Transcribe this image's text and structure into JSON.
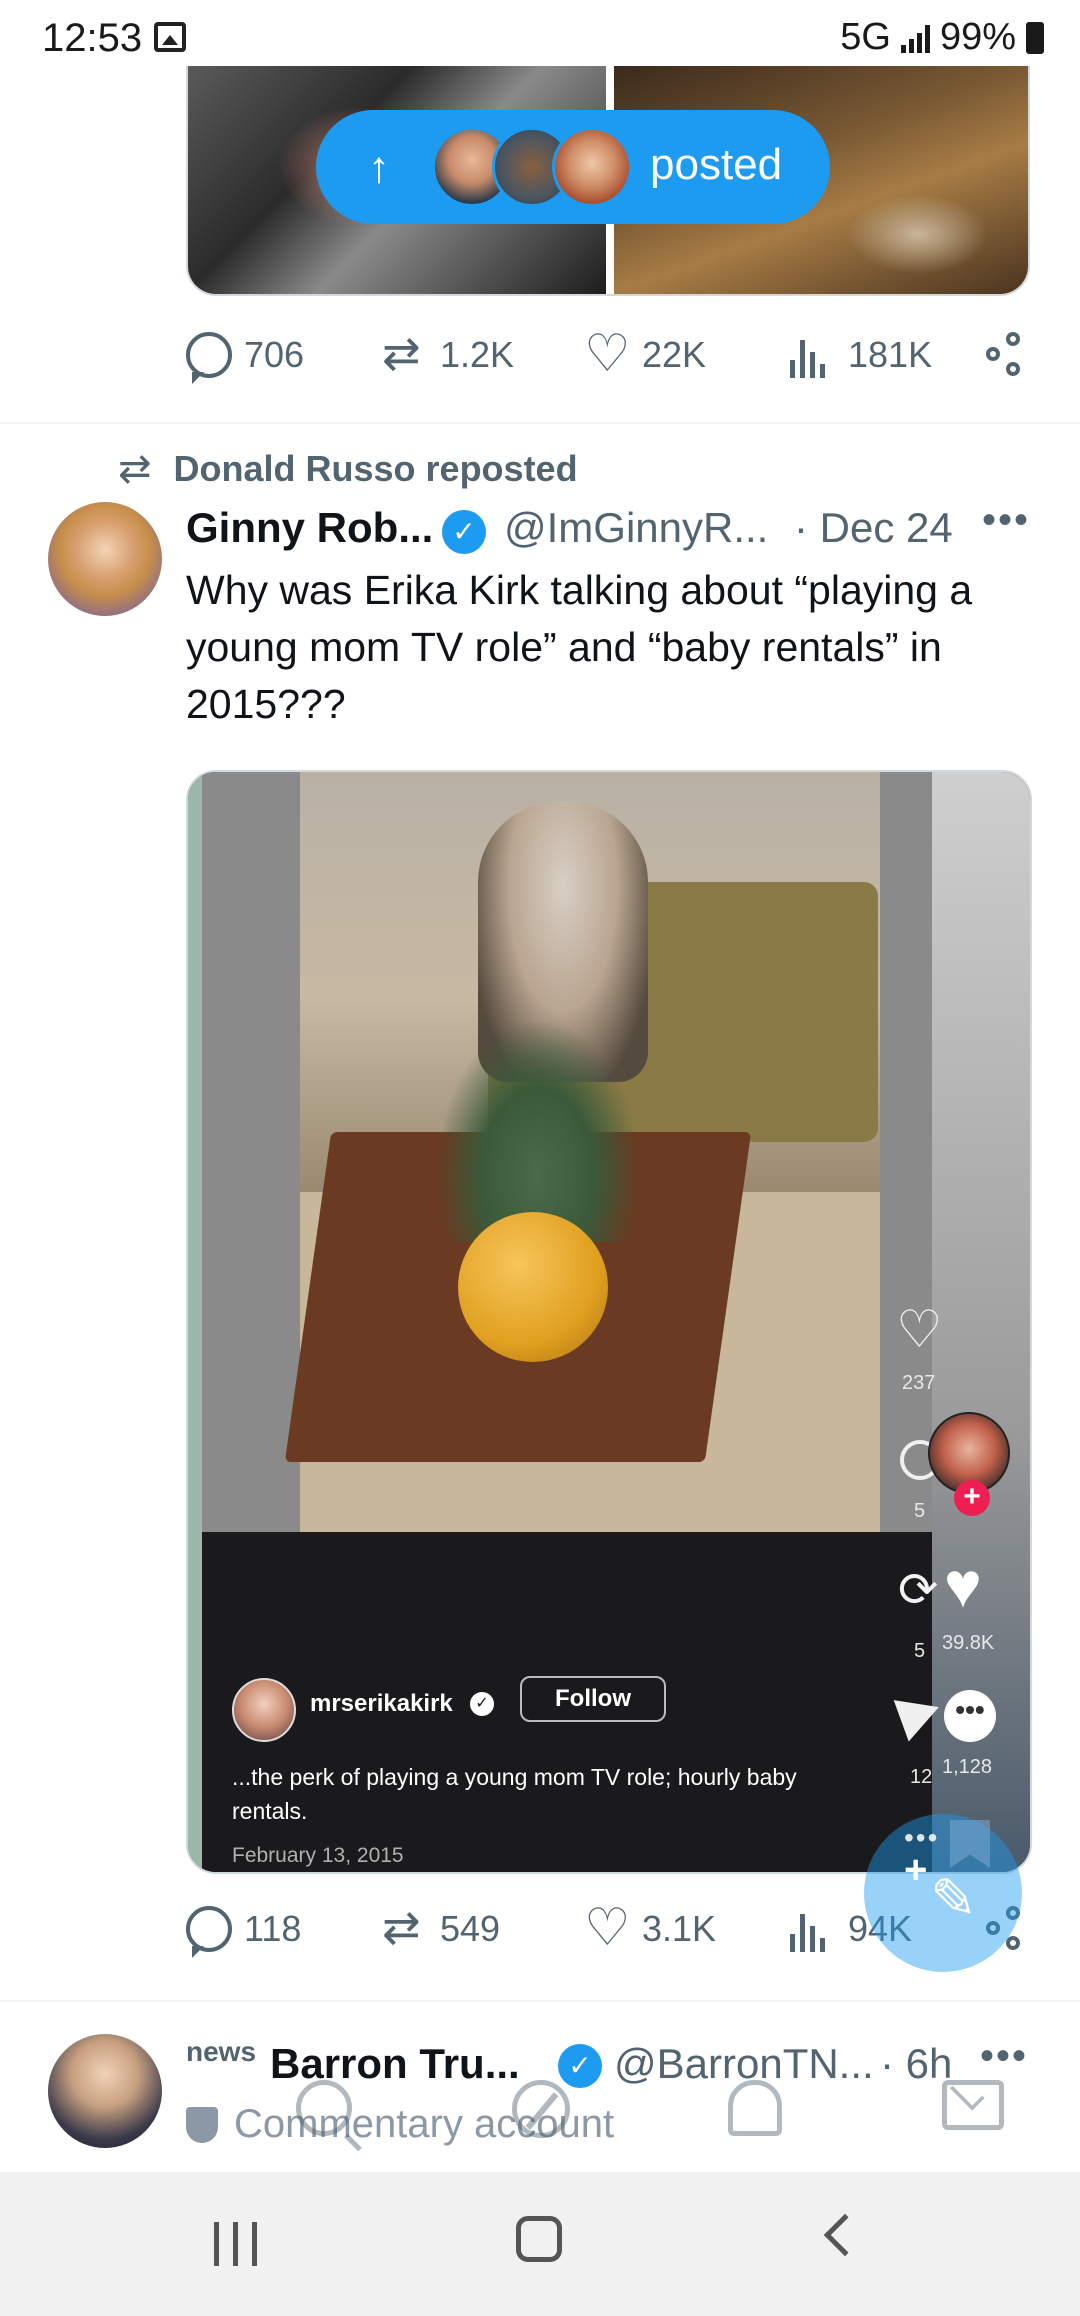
{
  "status_bar": {
    "time": "12:53",
    "network": "5G",
    "battery": "99%"
  },
  "new_posts_pill": {
    "label": "posted"
  },
  "prev_tweet": {
    "reply_count": "706",
    "retweet_count": "1.2K",
    "like_count": "22K",
    "view_count": "181K"
  },
  "tweet": {
    "reposted_by": "Donald Russo reposted",
    "author_name": "Ginny Rob...",
    "author_handle": "@ImGinnyR...",
    "date": "· Dec 24",
    "text": "Why was Erika Kirk talking about “playing a young mom TV role” and “baby rentals” in 2015???",
    "reply_count": "118",
    "retweet_count": "549",
    "like_count": "3.1K",
    "view_count": "94K",
    "video": {
      "side_like_count": "237",
      "side_comment_count": "5",
      "side_repost_count": "5",
      "big_like_count": "39.8K",
      "side_share_count": "12",
      "big_comment_count": "1,128",
      "username": "mrserikakirk",
      "follow_label": "Follow",
      "caption": "...the perk of playing a young mom TV role; hourly baby rentals.",
      "date": "February 13, 2015"
    }
  },
  "next_tweet": {
    "label": "news",
    "author_name": "Barron Tru...",
    "author_handle": "@BarronTN...",
    "time": "· 6h",
    "subtitle": "Commentary account"
  },
  "icons": {
    "reply": "reply-icon",
    "retweet": "retweet-icon",
    "like": "heart-icon",
    "views": "views-icon",
    "share": "share-icon",
    "compose": "compose-icon"
  },
  "colors": {
    "accent": "#1d9bf0",
    "secondary_text": "#536471",
    "tiktok_plus": "#ee1d52"
  }
}
